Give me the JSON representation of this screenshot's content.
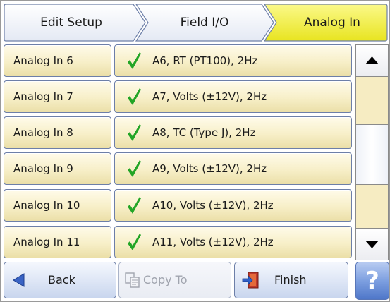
{
  "breadcrumb": {
    "items": [
      {
        "label": "Edit Setup",
        "active": false
      },
      {
        "label": "Field I/O",
        "active": false
      },
      {
        "label": "Analog In",
        "active": true
      }
    ]
  },
  "rows": [
    {
      "name": "Analog In 6",
      "status": "check-icon",
      "value": "A6, RT (PT100), 2Hz"
    },
    {
      "name": "Analog In 7",
      "status": "check-icon",
      "value": "A7, Volts (±12V), 2Hz"
    },
    {
      "name": "Analog In 8",
      "status": "check-icon",
      "value": "A8, TC (Type J), 2Hz"
    },
    {
      "name": "Analog In 9",
      "status": "check-icon",
      "value": "A9, Volts (±12V), 2Hz"
    },
    {
      "name": "Analog In 10",
      "status": "check-icon",
      "value": "A10, Volts (±12V), 2Hz"
    },
    {
      "name": "Analog In 11",
      "status": "check-icon",
      "value": "A11, Volts (±12V), 2Hz"
    }
  ],
  "toolbar": {
    "back_label": "Back",
    "copy_label": "Copy To",
    "finish_label": "Finish",
    "help_label": "?"
  },
  "colors": {
    "active_crumb": "#f0ee3a",
    "row_bg": "#f7efc8",
    "button_blue": "#dfe7f6",
    "check_green": "#23a526"
  }
}
